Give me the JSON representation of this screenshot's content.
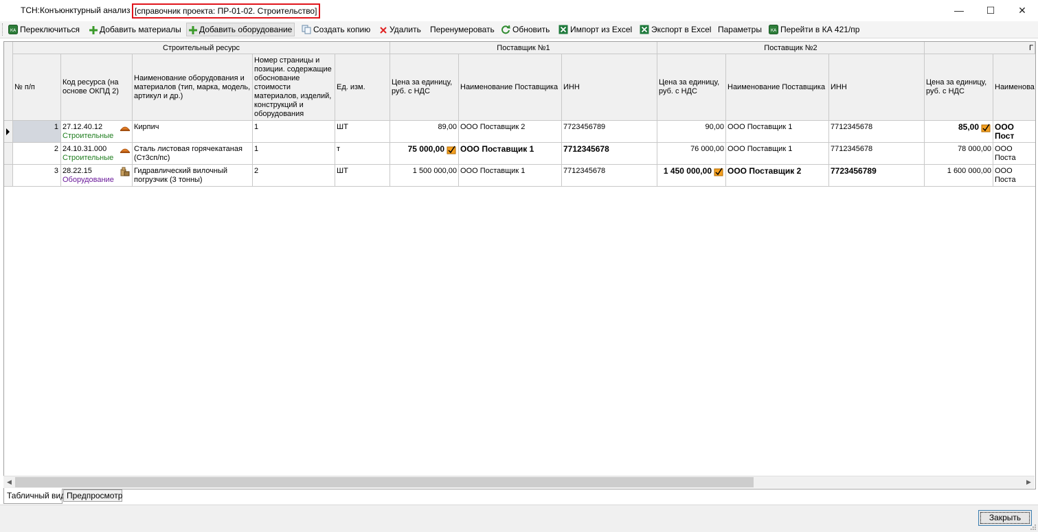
{
  "window": {
    "title": "ТСН:Конъюнктурный анализ",
    "title_highlight": "[справочник проекта: ПР-01-02. Строительство]",
    "minimize": "—",
    "maximize": "☐",
    "close": "✕"
  },
  "toolbar": {
    "switch": "Переключиться",
    "add_materials": "Добавить материалы",
    "add_equipment": "Добавить оборудование",
    "copy": "Создать копию",
    "delete": "Удалить",
    "renumber": "Перенумеровать",
    "refresh": "Обновить",
    "import_excel": "Импорт из Excel",
    "export_excel": "Экспорт в Excel",
    "params": "Параметры",
    "goto_ka": "Перейти в КА 421/пр"
  },
  "grid": {
    "groups": {
      "resource": "Строительный ресурс",
      "supplier1": "Поставщик №1",
      "supplier2": "Поставщик №2",
      "supplier3": "Г"
    },
    "columns": {
      "num": "№ п/п",
      "code": "Код ресурса (на основе ОКПД 2)",
      "name": "Наименование оборудования и материалов (тип, марка, модель, артикул и др.)",
      "page": "Номер страницы и позиции. содержащие обоснование стоимости материалов, изделий, конструкций и оборудования",
      "unit": "Ед. изм.",
      "price1": "Цена за единицу, руб. с НДС",
      "sup1": "Наименование Поставщика",
      "inn1": "ИНН",
      "price2": "Цена за единицу, руб. с НДС",
      "sup2": "Наименование Поставщика",
      "inn2": "ИНН",
      "price3": "Цена за единицу, руб. с НДС",
      "sup3": "Наименова"
    },
    "rows": [
      {
        "num": "1",
        "code": "27.12.40.12",
        "type": "Строительные",
        "name": "Кирпич",
        "page": "1",
        "unit": "ШТ",
        "price1": "89,00",
        "sup1": "ООО Поставщик 2",
        "inn1": "7723456789",
        "price2": "90,00",
        "sup2": "ООО Поставщик 1",
        "inn2": "7712345678",
        "price3": "85,00",
        "sup3": "ООО Пост"
      },
      {
        "num": "2",
        "code": "24.10.31.000",
        "type": "Строительные",
        "name": "Сталь листовая горячекатаная (Ст3сп/пс)",
        "page": "1",
        "unit": "т",
        "price1": "75 000,00",
        "sup1": "ООО Поставщик 1",
        "inn1": "7712345678",
        "price2": "76 000,00",
        "sup2": "ООО Поставщик 1",
        "inn2": "7712345678",
        "price3": "78 000,00",
        "sup3": "ООО Поста"
      },
      {
        "num": "3",
        "code": "28.22.15",
        "type": "Оборудование",
        "name": "Гидравлический вилочный погрузчик (3 тонны)",
        "page": "2",
        "unit": "ШТ",
        "price1": "1 500 000,00",
        "sup1": "ООО Поставщик 1",
        "inn1": "7712345678",
        "price2": "1 450 000,00",
        "sup2": "ООО Поставщик 2",
        "inn2": "7723456789",
        "price3": "1 600 000,00",
        "sup3": "ООО Поста"
      }
    ]
  },
  "tabs": {
    "table": "Табличный вид",
    "preview": "Предпросмотр"
  },
  "footer": {
    "close": "Закрыть"
  },
  "colors": {
    "highlight_border": "#e0141b",
    "type_building": "#1e7d1e",
    "type_equipment": "#6a1a9a",
    "selected_cell": "#d3d7de"
  }
}
